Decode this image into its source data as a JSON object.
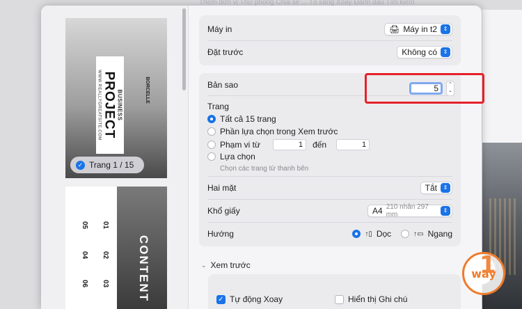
{
  "background": {
    "menu_text": "Thêm đơn vị   Thư phòng   Chia sẻ   ...   Tổ sáng   Xoay   Đánh dấu   Tìm kiếm"
  },
  "thumbnails": {
    "page1": {
      "title": "PROJECT",
      "subtitle": "BUSINESS",
      "website": "WWW.REALLYGREATSITE.COM",
      "brand": "BORCELLE",
      "badge": "Trang 1 / 15"
    },
    "page2": {
      "title": "CONTENT",
      "numbers": [
        "01",
        "02",
        "03",
        "05",
        "04",
        "06"
      ]
    }
  },
  "printer": {
    "label": "Máy in",
    "value": "Máy in t2"
  },
  "presets": {
    "label": "Đặt trước",
    "value": "Không có"
  },
  "copies": {
    "label": "Bản sao",
    "value": "5",
    "stepper_up": "⌃",
    "stepper_down": "⌄"
  },
  "pages": {
    "label": "Trang",
    "options": [
      {
        "label": "Tất cả 15 trang",
        "selected": true
      },
      {
        "label": "Phần lựa chọn trong Xem trước",
        "selected": false
      },
      {
        "label": "Phạm vi từ",
        "selected": false
      },
      {
        "label": "Lựa chọn",
        "selected": false
      }
    ],
    "range_from": "1",
    "range_to_label": "đến",
    "range_to": "1",
    "selection_hint": "Chọn các trang từ thanh bên"
  },
  "duplex": {
    "label": "Hai mặt",
    "value": "Tắt"
  },
  "paper_size": {
    "label": "Khổ giấy",
    "value": "A4",
    "detail": "210 nhân 297 mm"
  },
  "orientation": {
    "label": "Hướng",
    "portrait": "Dọc",
    "landscape": "Ngang",
    "selected": "portrait"
  },
  "preview_section": {
    "label": "Xem trước",
    "auto_rotate": "Tự động Xoay",
    "show_notes": "Hiển thị Ghi chú"
  },
  "colors": {
    "accent": "#1a73e8",
    "highlight": "#e5202b",
    "logo": "#f07b2a"
  }
}
